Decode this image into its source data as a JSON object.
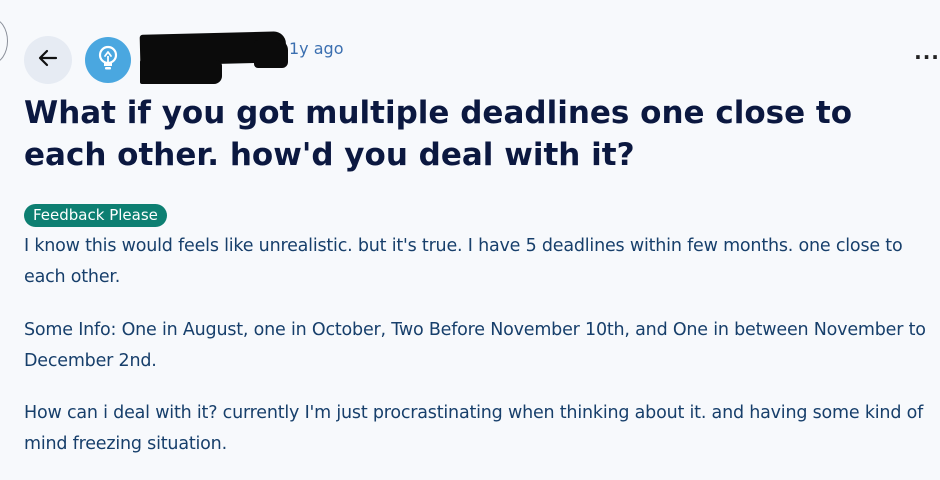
{
  "post": {
    "timestamp": "1y ago",
    "title": "What if you got multiple deadlines one close to each other. how'd you deal with it?",
    "flair": "Feedback Please",
    "body": [
      "I know this would feels like unrealistic. but it's true. I have 5 deadlines within few months. one close to each other.",
      "Some Info: One in August, one in October, Two Before November 10th, and One in between November to December 2nd.",
      "How can i deal with it? currently I'm just procrastinating when thinking about it. and having some kind of mind freezing situation."
    ]
  },
  "icons": {
    "back": "arrow-left-icon",
    "avatar": "lightbulb-icon",
    "more": "more-options-icon"
  },
  "colors": {
    "background": "#f7f9fc",
    "title": "#0b1840",
    "body_text": "#173f6b",
    "flair_bg": "#0d7f72",
    "avatar_bg": "#4aa7e0",
    "timestamp": "#3b6fb0"
  }
}
